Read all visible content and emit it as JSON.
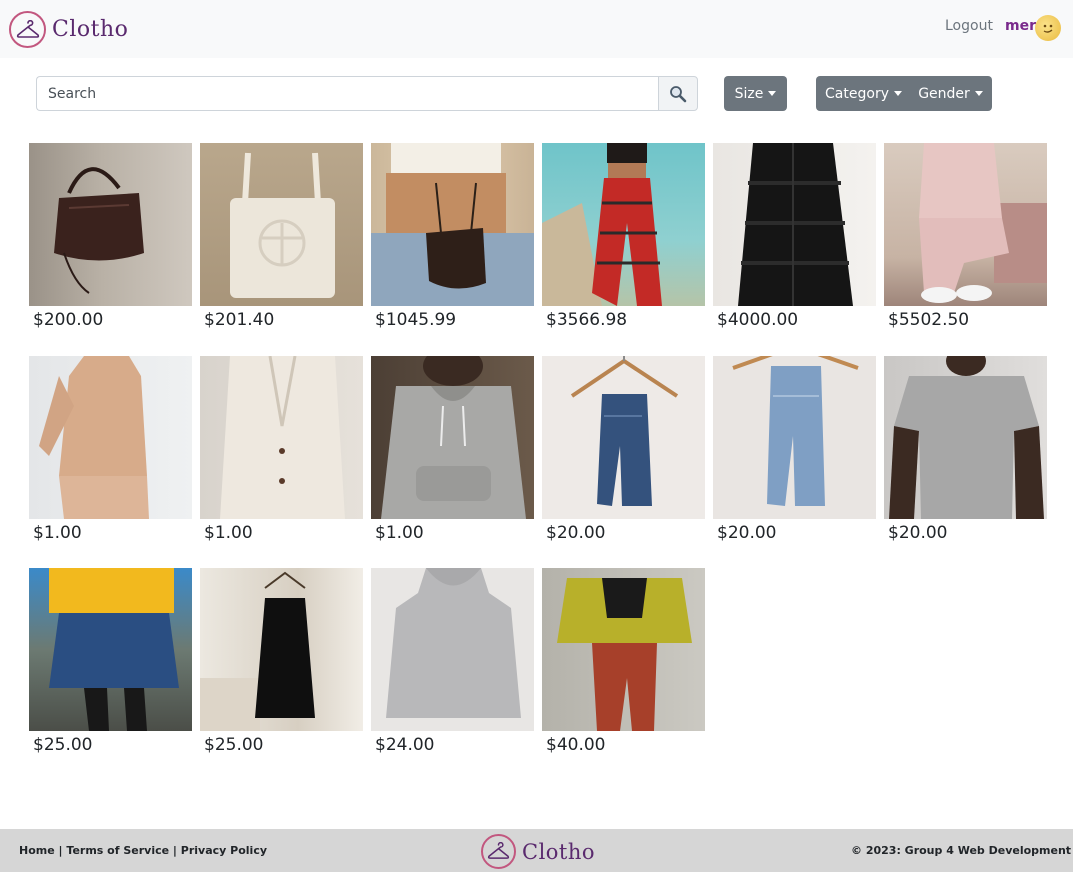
{
  "header": {
    "brand": "Clotho",
    "logout": "Logout",
    "username": "mer"
  },
  "search": {
    "placeholder": "Search"
  },
  "filters": {
    "size": "Size",
    "category": "Category",
    "gender": "Gender"
  },
  "products": [
    {
      "price": "$200.00"
    },
    {
      "price": "$201.40"
    },
    {
      "price": "$1045.99"
    },
    {
      "price": "$3566.98"
    },
    {
      "price": "$4000.00"
    },
    {
      "price": "$5502.50"
    },
    {
      "price": "$1.00"
    },
    {
      "price": "$1.00"
    },
    {
      "price": "$1.00"
    },
    {
      "price": "$20.00"
    },
    {
      "price": "$20.00"
    },
    {
      "price": "$20.00"
    },
    {
      "price": "$25.00"
    },
    {
      "price": "$25.00"
    },
    {
      "price": "$24.00"
    },
    {
      "price": "$40.00"
    }
  ],
  "footer": {
    "home": "Home",
    "sep": "|",
    "terms": "Terms of Service",
    "privacy": "Privacy Policy",
    "brand": "Clotho",
    "copyright": "© 2023: Group 4 Web Development"
  }
}
